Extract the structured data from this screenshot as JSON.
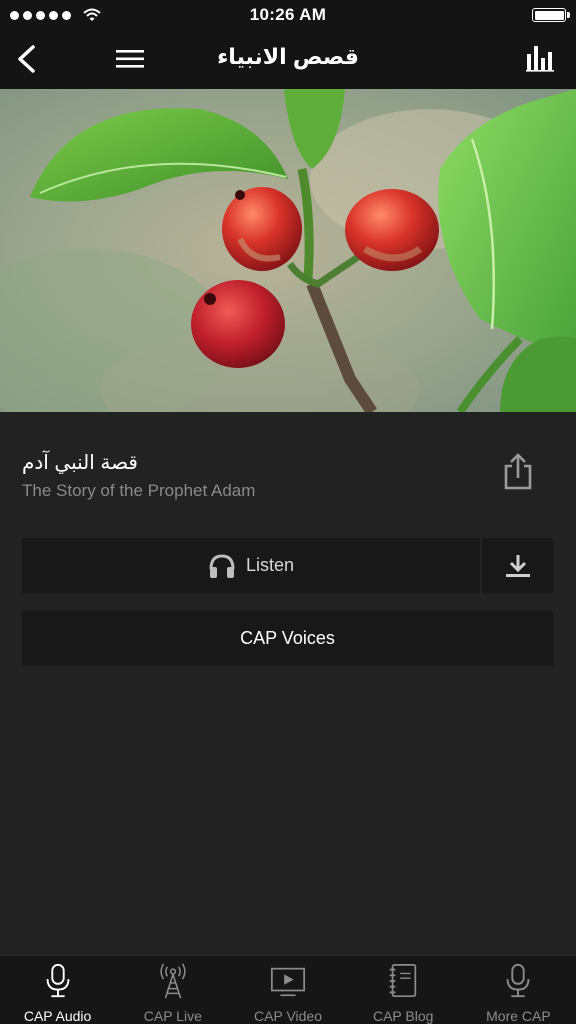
{
  "status_bar": {
    "time": "10:26 AM",
    "signal_dots": 5,
    "battery_level": 1.0
  },
  "nav": {
    "title": "قصص الانبياء",
    "back_icon": "chevron-left-icon",
    "menu_icon": "hamburger-menu-icon",
    "stats_icon": "bar-chart-icon"
  },
  "hero": {
    "description_icon": "coffee-berries-photo"
  },
  "track": {
    "title_ar": "قصة النبي آدم",
    "title_en": "The Story of the Prophet Adam"
  },
  "actions": {
    "listen_label": "Listen",
    "voices_label": "CAP Voices",
    "share_icon": "share-icon",
    "download_icon": "download-icon",
    "headphones_icon": "headphones-icon"
  },
  "tabs": [
    {
      "label": "CAP Audio",
      "icon": "microphone-icon",
      "active": true
    },
    {
      "label": "CAP Live",
      "icon": "broadcast-tower-icon",
      "active": false
    },
    {
      "label": "CAP Video",
      "icon": "video-play-icon",
      "active": false
    },
    {
      "label": "CAP Blog",
      "icon": "notebook-icon",
      "active": false
    },
    {
      "label": "More CAP",
      "icon": "microphone-icon",
      "active": false
    }
  ],
  "colors": {
    "background": "#222222",
    "bar_background": "#141414",
    "button_background": "#181818",
    "muted_text": "#8a8a8a",
    "inactive_tab": "#8c8c8c"
  }
}
